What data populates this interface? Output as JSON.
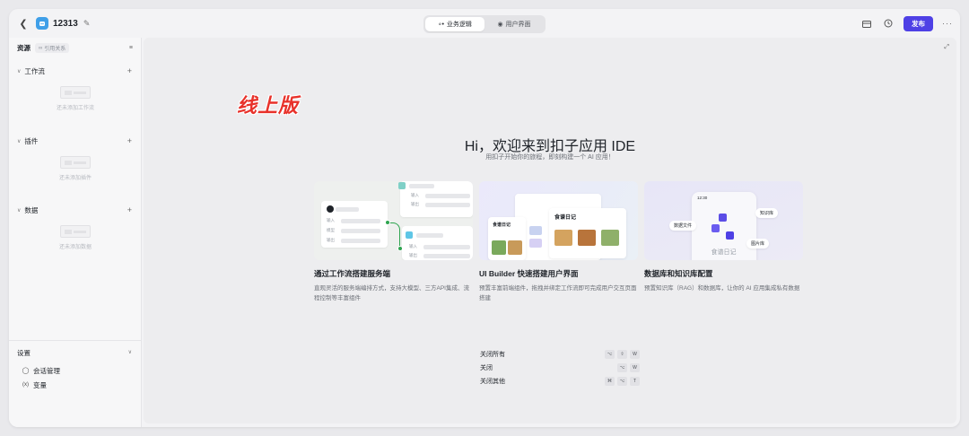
{
  "topbar": {
    "back_icon": "chevron-left-icon",
    "app_name": "12313",
    "tabs": [
      {
        "label": "业务逻辑",
        "icon": "flow-icon",
        "active": true
      },
      {
        "label": "用户界面",
        "icon": "palette-icon",
        "active": false
      }
    ],
    "publish_label": "发布",
    "more_label": "···"
  },
  "sidebar": {
    "title": "资源",
    "ref_chip": "引用关系",
    "sections": [
      {
        "title": "工作流",
        "empty_text": "还未添加工作流"
      },
      {
        "title": "插件",
        "empty_text": "还未添加插件"
      },
      {
        "title": "数据",
        "empty_text": "还未添加数据"
      }
    ],
    "settings": {
      "title": "设置",
      "items": [
        {
          "label": "会话管理",
          "icon": "chat-icon"
        },
        {
          "label": "变量",
          "icon": "variable-icon"
        }
      ]
    }
  },
  "main": {
    "brand_tag": "线上版",
    "hero_title": "Hi，欢迎来到扣子应用 IDE",
    "hero_subtitle": "用扣子开始你的旅程，即刻构建一个 AI 应用！",
    "cards": [
      {
        "title": "通过工作流搭建服务端",
        "desc": "直观灵活的服务端编排方式，支持大模型、三方API集成、流程控制等丰富组件",
        "illus": {
          "in1": "输入",
          "in2": "输出",
          "in3": "模型",
          "in4": "输出"
        }
      },
      {
        "title": "UI Builder 快速搭建用户界面",
        "desc": "预置丰富前端组件，拖拽并绑定工作流即可完成用户交互页面搭建",
        "illus": {
          "screen_title": "食谱日记",
          "screen_title2": "食谱日记"
        }
      },
      {
        "title": "数据库和知识库配置",
        "desc": "预置知识库（RAG）和数据库，让你的 AI 应用集成私有数据",
        "illus": {
          "tag1": "知识库",
          "tag2": "数据文件",
          "tag3": "图片库",
          "caption": "食谱日记",
          "time": "12:30"
        }
      }
    ],
    "shortcuts": [
      {
        "label": "关闭所有",
        "keys": [
          "⌥",
          "⇧",
          "W"
        ]
      },
      {
        "label": "关闭",
        "keys": [
          "⌥",
          "W"
        ]
      },
      {
        "label": "关闭其他",
        "keys": [
          "⌘",
          "⌥",
          "T"
        ]
      }
    ]
  },
  "colors": {
    "accent": "#4e40e5",
    "brand_tag": "#e8312a",
    "app_icon": "#3f9fe8",
    "flow_green": "#2ea44f"
  }
}
